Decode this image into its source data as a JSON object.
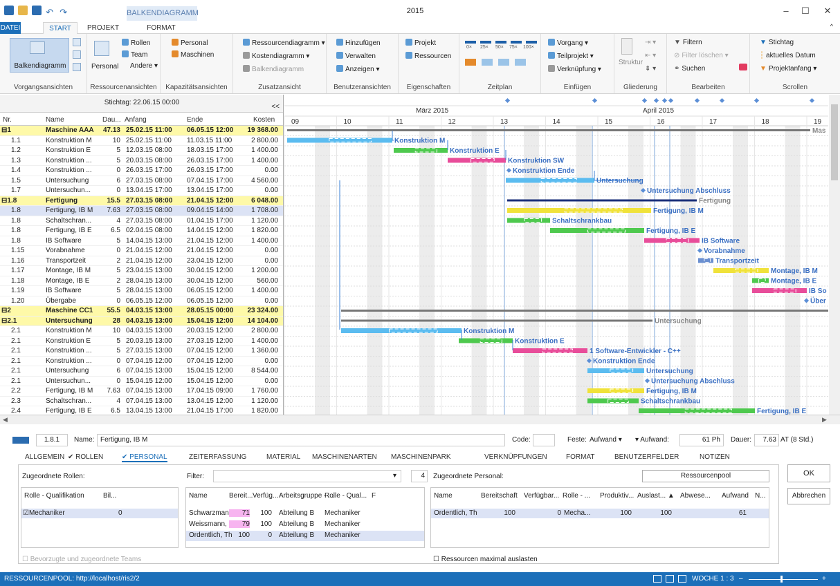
{
  "window": {
    "title": "2015",
    "context_group": "BALKENDIAGRAMM",
    "controls": [
      "–",
      "☐",
      "✕"
    ]
  },
  "tabs": [
    {
      "label": "DATEI",
      "active_file": true
    },
    {
      "label": "START",
      "selected": true
    },
    {
      "label": "PROJEKT"
    },
    {
      "label": "FORMAT"
    }
  ],
  "ribbon": {
    "groups": [
      {
        "label": "Vorgangsansichten",
        "big": "Balkendiagramm"
      },
      {
        "label": "Ressourcenansichten",
        "big": "Personal",
        "items": [
          "Rollen",
          "Team",
          "Andere ▾"
        ]
      },
      {
        "label": "Kapazitätsansichten",
        "items": [
          "Personal",
          "Maschinen"
        ]
      },
      {
        "label": "Zusatzansicht",
        "items": [
          "Ressourcendiagramm ▾",
          "Kostendiagramm ▾",
          "Balkendiagramm"
        ]
      },
      {
        "label": "Benutzeransichten",
        "items": [
          "Hinzufügen",
          "Verwalten",
          "Anzeigen ▾"
        ]
      },
      {
        "label": "Eigenschaften",
        "items": [
          "Projekt",
          "Ressourcen"
        ]
      },
      {
        "label": "Zeitplan",
        "zoom": [
          "0×",
          "25×",
          "50×",
          "75×",
          "100×"
        ]
      },
      {
        "label": "Einfügen",
        "items": [
          "Vorgang ▾",
          "Teilprojekt ▾",
          "Verknüpfung ▾"
        ]
      },
      {
        "label": "Gliederung",
        "items": [
          "Struktur"
        ]
      },
      {
        "label": "Bearbeiten",
        "items": [
          "Filtern",
          "Filter löschen ▾",
          "Suchen"
        ]
      },
      {
        "label": "Scrollen",
        "items": [
          "Stichtag",
          "aktuelles Datum",
          "Projektanfang ▾"
        ]
      }
    ]
  },
  "grid": {
    "stichtag": "Stichtag: 22.06.15 00:00",
    "collapse": "<<",
    "columns": [
      "Nr.",
      "Name",
      "Dau...",
      "Anfang",
      "Ende",
      "Kosten"
    ],
    "rows": [
      {
        "nr": "⊟1",
        "name": "Maschine AAA",
        "dur": "47.13",
        "start": "25.02.15 11:00",
        "end": "06.05.15 12:00",
        "cost": "19 368.00",
        "type": "sum"
      },
      {
        "nr": "1.1",
        "name": "Konstruktion M",
        "dur": "10",
        "start": "25.02.15 11:00",
        "end": "11.03.15 11:00",
        "cost": "2 800.00"
      },
      {
        "nr": "1.2",
        "name": "Konstruktion E",
        "dur": "5",
        "start": "12.03.15 08:00",
        "end": "18.03.15 17:00",
        "cost": "1 400.00"
      },
      {
        "nr": "1.3",
        "name": "Konstruktion ...",
        "dur": "5",
        "start": "20.03.15 08:00",
        "end": "26.03.15 17:00",
        "cost": "1 400.00"
      },
      {
        "nr": "1.4",
        "name": "Konstruktion ...",
        "dur": "0",
        "start": "26.03.15 17:00",
        "end": "26.03.15 17:00",
        "cost": "0.00"
      },
      {
        "nr": "1.5",
        "name": "Untersuchung",
        "dur": "6",
        "start": "27.03.15 08:00",
        "end": "07.04.15 17:00",
        "cost": "4 560.00"
      },
      {
        "nr": "1.7",
        "name": "Untersuchun...",
        "dur": "0",
        "start": "13.04.15 17:00",
        "end": "13.04.15 17:00",
        "cost": "0.00"
      },
      {
        "nr": "⊟1.8",
        "name": "Fertigung",
        "dur": "15.5",
        "start": "27.03.15 08:00",
        "end": "21.04.15 12:00",
        "cost": "6 048.00",
        "type": "sum"
      },
      {
        "nr": "1.8",
        "name": "Fertigung, IB M",
        "dur": "7.63",
        "start": "27.03.15 08:00",
        "end": "09.04.15 14:00",
        "cost": "1 708.00",
        "type": "sel"
      },
      {
        "nr": "1.8",
        "name": "Schaltschran...",
        "dur": "4",
        "start": "27.03.15 08:00",
        "end": "01.04.15 17:00",
        "cost": "1 120.00"
      },
      {
        "nr": "1.8",
        "name": "Fertigung, IB E",
        "dur": "6.5",
        "start": "02.04.15 08:00",
        "end": "14.04.15 12:00",
        "cost": "1 820.00"
      },
      {
        "nr": "1.8",
        "name": "IB Software",
        "dur": "5",
        "start": "14.04.15 13:00",
        "end": "21.04.15 12:00",
        "cost": "1 400.00"
      },
      {
        "nr": "1.15",
        "name": "Vorabnahme",
        "dur": "0",
        "start": "21.04.15 12:00",
        "end": "21.04.15 12:00",
        "cost": "0.00"
      },
      {
        "nr": "1.16",
        "name": "Transportzeit",
        "dur": "2",
        "start": "21.04.15 12:00",
        "end": "23.04.15 12:00",
        "cost": "0.00"
      },
      {
        "nr": "1.17",
        "name": "Montage, IB M",
        "dur": "5",
        "start": "23.04.15 13:00",
        "end": "30.04.15 12:00",
        "cost": "1 200.00"
      },
      {
        "nr": "1.18",
        "name": "Montage, IB E",
        "dur": "2",
        "start": "28.04.15 13:00",
        "end": "30.04.15 12:00",
        "cost": "560.00"
      },
      {
        "nr": "1.19",
        "name": "IB Software",
        "dur": "5",
        "start": "28.04.15 13:00",
        "end": "06.05.15 12:00",
        "cost": "1 400.00"
      },
      {
        "nr": "1.20",
        "name": "Übergabe",
        "dur": "0",
        "start": "06.05.15 12:00",
        "end": "06.05.15 12:00",
        "cost": "0.00"
      },
      {
        "nr": "⊟2",
        "name": "Maschine CC1",
        "dur": "55.5",
        "start": "04.03.15 13:00",
        "end": "28.05.15 00:00",
        "cost": "23 324.00",
        "type": "sum"
      },
      {
        "nr": "⊟2.1",
        "name": "Untersuchung",
        "dur": "28",
        "start": "04.03.15 13:00",
        "end": "15.04.15 12:00",
        "cost": "14 104.00",
        "type": "sum"
      },
      {
        "nr": "2.1",
        "name": "Konstruktion M",
        "dur": "10",
        "start": "04.03.15 13:00",
        "end": "20.03.15 12:00",
        "cost": "2 800.00"
      },
      {
        "nr": "2.1",
        "name": "Konstruktion E",
        "dur": "5",
        "start": "20.03.15 13:00",
        "end": "27.03.15 12:00",
        "cost": "1 400.00"
      },
      {
        "nr": "2.1",
        "name": "Konstruktion ...",
        "dur": "5",
        "start": "27.03.15 13:00",
        "end": "07.04.15 12:00",
        "cost": "1 360.00"
      },
      {
        "nr": "2.1",
        "name": "Konstruktion ...",
        "dur": "0",
        "start": "07.04.15 12:00",
        "end": "07.04.15 12:00",
        "cost": "0.00"
      },
      {
        "nr": "2.1",
        "name": "Untersuchung",
        "dur": "6",
        "start": "07.04.15 13:00",
        "end": "15.04.15 12:00",
        "cost": "8 544.00"
      },
      {
        "nr": "2.1",
        "name": "Untersuchun...",
        "dur": "0",
        "start": "15.04.15 12:00",
        "end": "15.04.15 12:00",
        "cost": "0.00"
      },
      {
        "nr": "2.2",
        "name": "Fertigung, IB M",
        "dur": "7.63",
        "start": "07.04.15 13:00",
        "end": "17.04.15 09:00",
        "cost": "1 760.00"
      },
      {
        "nr": "2.3",
        "name": "Schaltschran...",
        "dur": "4",
        "start": "07.04.15 13:00",
        "end": "13.04.15 12:00",
        "cost": "1 120.00"
      },
      {
        "nr": "2.4",
        "name": "Fertigung, IB E",
        "dur": "6.5",
        "start": "13.04.15 13:00",
        "end": "21.04.15 17:00",
        "cost": "1 820.00"
      }
    ]
  },
  "chart": {
    "months": [
      "März 2015",
      "April 2015"
    ],
    "weeks": [
      "09",
      "10",
      "11",
      "12",
      "13",
      "14",
      "15",
      "16",
      "17",
      "18",
      "19"
    ],
    "bar_labels": [
      "Konstruktion M",
      "Konstruktion E",
      "Konstruktion SW",
      "Konstruktion Ende",
      "Untersuchung",
      "Untersuchung Abschluss",
      "Fertigung",
      "Fertigung, IB M",
      "Schaltschrankbau",
      "Fertigung, IB E",
      "IB Software",
      "Vorabnahme",
      "Transportzeit",
      "Montage, IB M",
      "Montage, IB E",
      "IB So",
      "Über",
      "Mas",
      "Untersuchung",
      "Konstruktion M",
      "Konstruktion E",
      "1 Software-Entwickler - C++",
      "Konstruktion Ende",
      "Untersuchung",
      "Untersuchung Abschluss",
      "Fertigung, IB M",
      "Schaltschrankbau",
      "Fertigung, IB E"
    ]
  },
  "detail": {
    "id": "1.8.1",
    "name_label": "Name:",
    "name": "Fertigung, IB M",
    "code_label": "Code:",
    "code": "",
    "feste_label": "Feste:",
    "feste": "Aufwand",
    "aufwand_label": "Aufwand:",
    "aufwand": "61",
    "aufwand_unit": "Ph",
    "dauer_label": "Dauer:",
    "dauer": "7.63",
    "dauer_unit": "AT (8 Std.)",
    "tabs": [
      "ALLGEMEIN",
      "✔ ROLLEN",
      "✔ PERSONAL",
      "ZEITERFASSUNG",
      "MATERIAL",
      "MASCHINENARTEN",
      "MASCHINENPARK",
      "VERKNÜPFUNGEN",
      "FORMAT",
      "BENUTZERFELDER",
      "NOTIZEN"
    ],
    "roles_label": "Zugeordnete Rollen:",
    "roles_cols": [
      "Rolle - Qualifikation",
      "Bil..."
    ],
    "roles": [
      {
        "name": "☑Mechaniker",
        "val": "0"
      }
    ],
    "teams_label": "Bevorzugte und zugeordnete Teams",
    "filter_label": "Filter:",
    "filter_count": "4",
    "pers_cols": [
      "Name",
      "Bereit...",
      "Verfüg...",
      "Arbeitsgruppe - ...",
      "Rolle - Qual...",
      "F"
    ],
    "personnel": [
      {
        "name": "Schwarzmann, Nik",
        "bereit": "71",
        "verf": "100",
        "gruppe": "Abteilung B",
        "rolle": "Mechaniker"
      },
      {
        "name": "Weissmann, Uwe",
        "bereit": "79",
        "verf": "100",
        "gruppe": "Abteilung B",
        "rolle": "Mechaniker"
      },
      {
        "name": "Ordentlich, Thoma",
        "bereit": "100",
        "verf": "0",
        "gruppe": "Abteilung B",
        "rolle": "Mechaniker"
      }
    ],
    "assigned_label": "Zugeordnete Personal:",
    "pool_button": "Ressourcenpool",
    "assigned_cols": [
      "Name",
      "Bereitschaft",
      "Verfügbar...",
      "Rolle - ...",
      "Produktiv...",
      "Auslast... ▲",
      "Abwese...",
      "Aufwand",
      "N..."
    ],
    "assigned": [
      {
        "name": "Ordentlich, Th",
        "bereit": "100",
        "verf": "0",
        "rolle": "Mecha...",
        "prod": "100",
        "ausl": "100",
        "aufwand": "61"
      }
    ],
    "max_label": "Ressourcen maximal auslasten",
    "ok": "OK",
    "cancel": "Abbrechen"
  },
  "status": {
    "pool": "RESSOURCENPOOL: http://localhost/ris2/2",
    "zoom": "WOCHE 1 : 3"
  }
}
